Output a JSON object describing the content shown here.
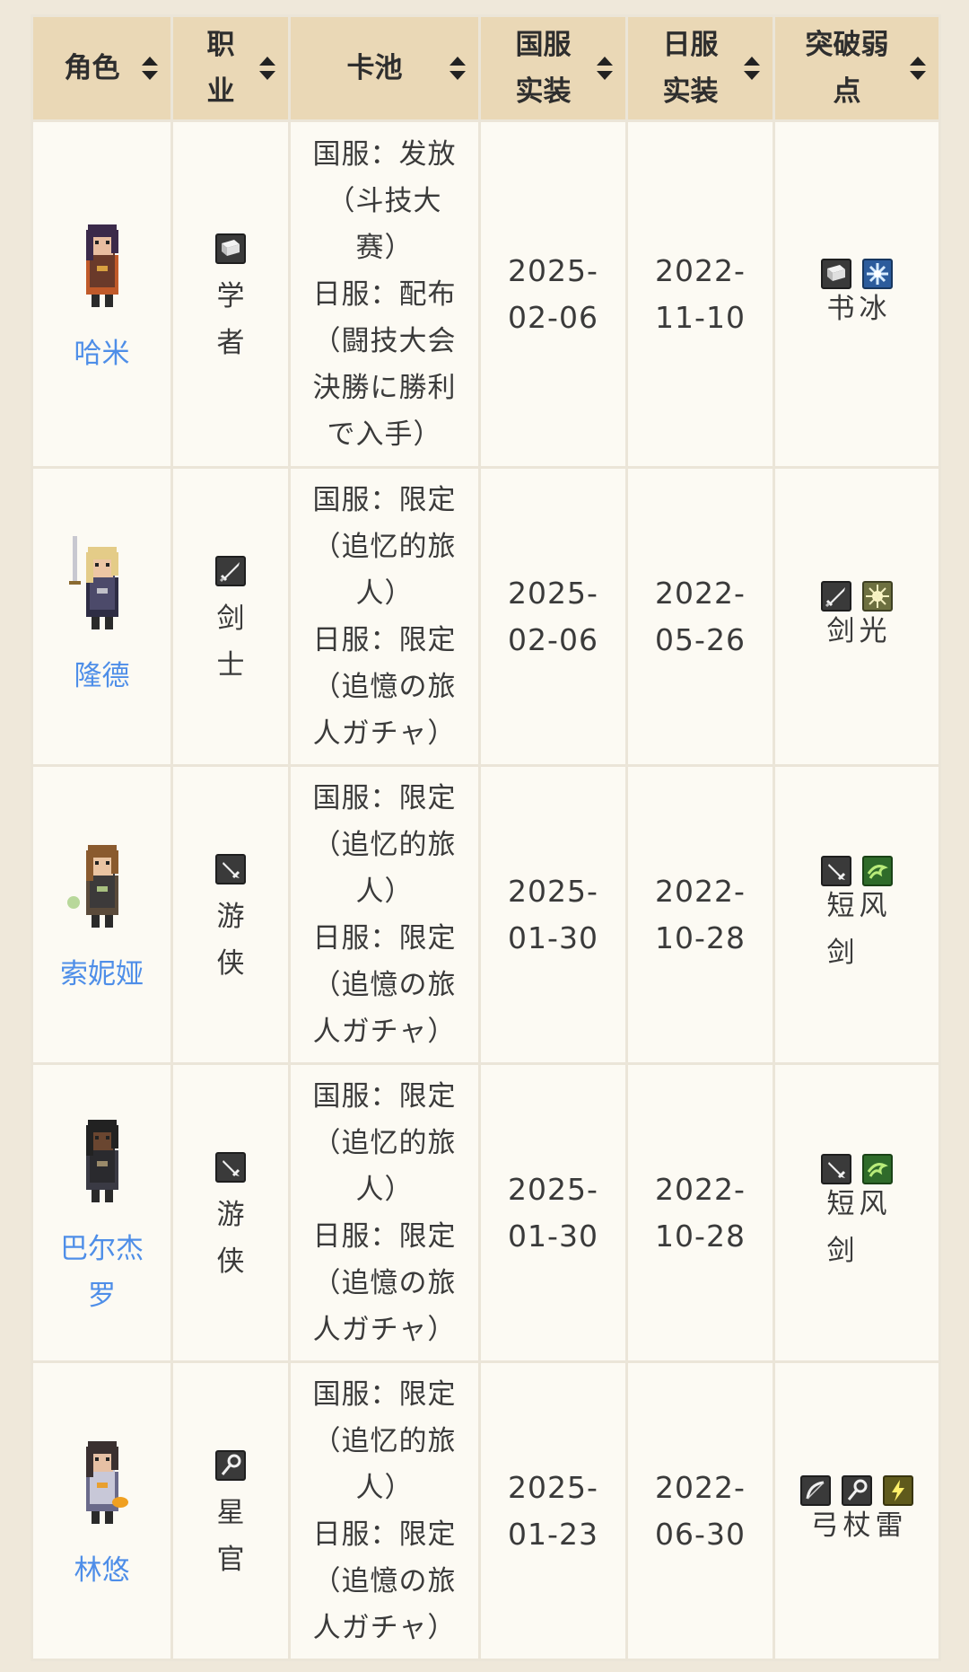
{
  "headers": [
    "角色",
    "职业",
    "卡池",
    "国服实装",
    "日服实装",
    "突破弱点"
  ],
  "header_lines": {
    "role": [
      "角色"
    ],
    "job": [
      "职",
      "业"
    ],
    "pool": [
      "卡池"
    ],
    "cn": [
      "国服",
      "实装"
    ],
    "jp": [
      "日服",
      "实装"
    ],
    "weak": [
      "突破弱",
      "点"
    ]
  },
  "rows": [
    {
      "name_lines": [
        "哈米"
      ],
      "job_icon": "book-icon",
      "job_lines": [
        "学",
        "者"
      ],
      "pool_lines": [
        "国服：发放",
        "（斗技大",
        "赛）",
        "日服：配布",
        "（闘技大会",
        "決勝に勝利",
        "で入手）"
      ],
      "cn_lines": [
        "2025-",
        "02-06"
      ],
      "jp_lines": [
        "2022-",
        "11-10"
      ],
      "weak_icons": [
        "book-icon",
        "ice-icon"
      ],
      "weak_line1": [
        "书",
        "冰"
      ],
      "weak_line2": []
    },
    {
      "name_lines": [
        "隆德"
      ],
      "job_icon": "sword-icon",
      "job_lines": [
        "剑",
        "士"
      ],
      "pool_lines": [
        "国服：限定",
        "（追忆的旅",
        "人）",
        "日服：限定",
        "（追憶の旅",
        "人ガチャ）"
      ],
      "cn_lines": [
        "2025-",
        "02-06"
      ],
      "jp_lines": [
        "2022-",
        "05-26"
      ],
      "weak_icons": [
        "sword-icon",
        "light-icon"
      ],
      "weak_line1": [
        "剑",
        "光"
      ],
      "weak_line2": []
    },
    {
      "name_lines": [
        "索妮娅"
      ],
      "job_icon": "dagger-icon",
      "job_lines": [
        "游",
        "侠"
      ],
      "pool_lines": [
        "国服：限定",
        "（追忆的旅",
        "人）",
        "日服：限定",
        "（追憶の旅",
        "人ガチャ）"
      ],
      "cn_lines": [
        "2025-",
        "01-30"
      ],
      "jp_lines": [
        "2022-",
        "10-28"
      ],
      "weak_icons": [
        "dagger-icon",
        "wind-icon"
      ],
      "weak_line1": [
        "短",
        "风"
      ],
      "weak_line2": [
        "剑",
        ""
      ]
    },
    {
      "name_lines": [
        "巴尔杰",
        "罗"
      ],
      "job_icon": "dagger-icon",
      "job_lines": [
        "游",
        "侠"
      ],
      "pool_lines": [
        "国服：限定",
        "（追忆的旅",
        "人）",
        "日服：限定",
        "（追憶の旅",
        "人ガチャ）"
      ],
      "cn_lines": [
        "2025-",
        "01-30"
      ],
      "jp_lines": [
        "2022-",
        "10-28"
      ],
      "weak_icons": [
        "dagger-icon",
        "wind-icon"
      ],
      "weak_line1": [
        "短",
        "风"
      ],
      "weak_line2": [
        "剑",
        ""
      ]
    },
    {
      "name_lines": [
        "林悠"
      ],
      "job_icon": "staff-icon",
      "job_lines": [
        "星",
        "官"
      ],
      "pool_lines": [
        "国服：限定",
        "（追忆的旅",
        "人）",
        "日服：限定",
        "（追憶の旅",
        "人ガチャ）"
      ],
      "cn_lines": [
        "2025-",
        "01-23"
      ],
      "jp_lines": [
        "2022-",
        "06-30"
      ],
      "weak_icons": [
        "bow-icon",
        "staff-icon",
        "thunder-icon"
      ],
      "weak_line1": [
        "弓",
        "杖",
        "雷"
      ],
      "weak_line2": []
    }
  ],
  "colors": {
    "header_bg": "#ead8b6",
    "cell_bg": "#fcfaf3",
    "link": "#4e8ee8",
    "page_bg": "#efe8da"
  }
}
